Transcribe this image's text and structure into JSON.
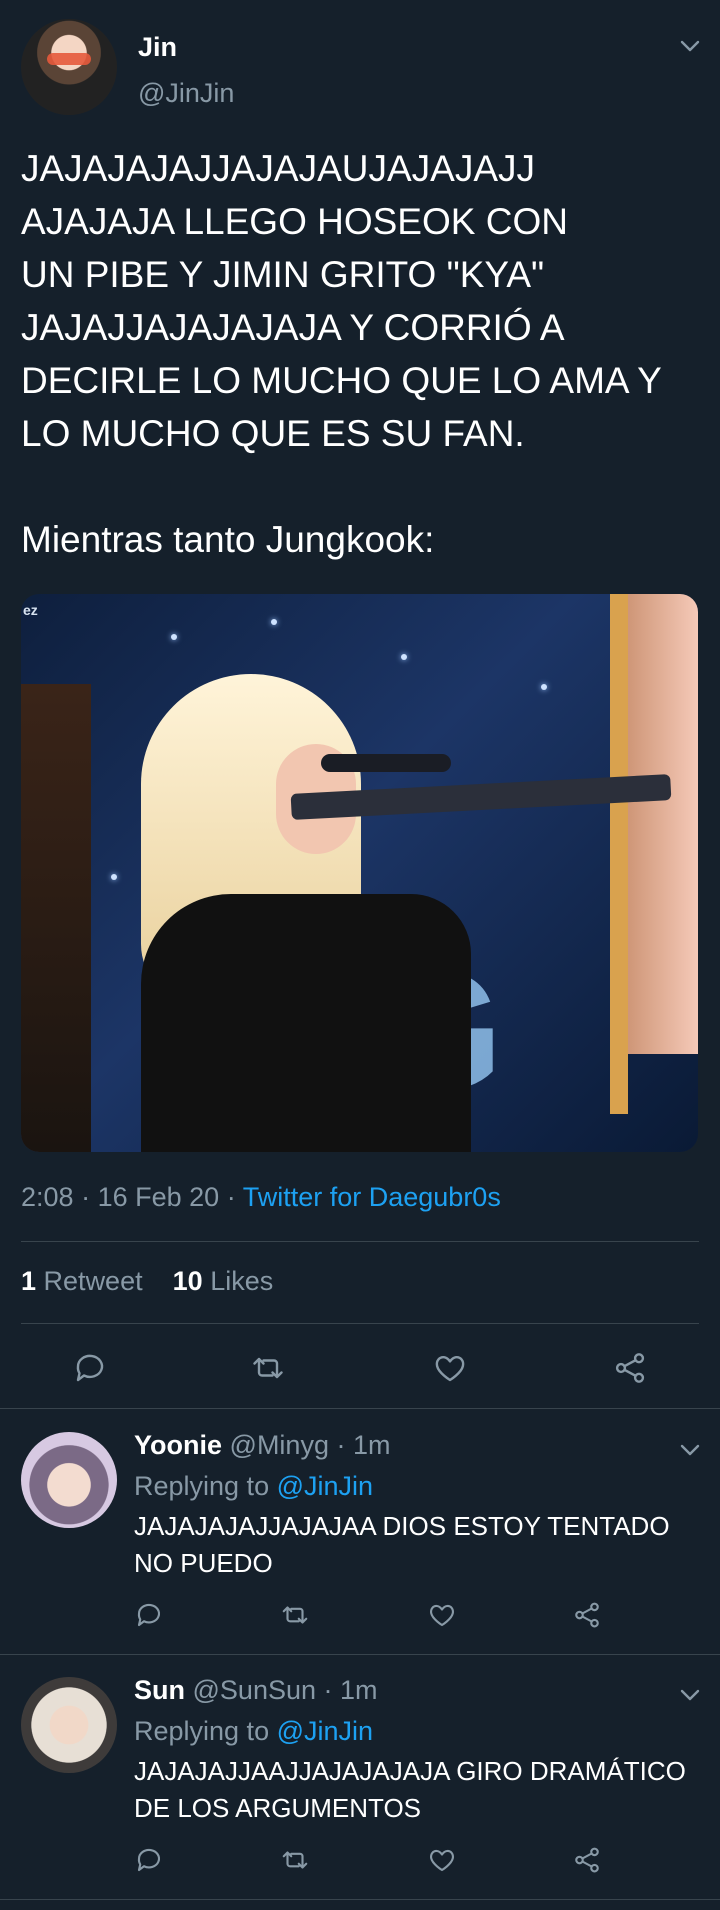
{
  "tweet": {
    "name": "Jin",
    "handle": "@JinJin",
    "text": "JAJAJAJAJJAJAJAUJAJAJAJJ\nAJAJAJA LLEGO HOSEOK CON\nUN PIBE Y JIMIN GRITO \"KYA\"\nJAJAJJAJAJAJAJA Y CORRIÓ A\nDECIRLE LO MUCHO QUE LO AMA Y\nLO MUCHO QUE ES SU FAN.\n\nMientras tanto Jungkook:",
    "media_watermark": "ez",
    "time": "2:08",
    "date": "16 Feb 20",
    "dot": "·",
    "source": "Twitter for Daegubr0s",
    "retweets_count": "1",
    "retweets_label": "Retweet",
    "likes_count": "10",
    "likes_label": "Likes"
  },
  "replies": [
    {
      "name": "Yoonie",
      "handle": "@Minyg",
      "time": "· 1m",
      "replying_label": "Replying to",
      "replying_to": "@JinJin",
      "text": "JAJAJAJAJJAJAJAA DIOS ESTOY TENTADO NO PUEDO"
    },
    {
      "name": "Sun",
      "handle": "@SunSun",
      "time": "· 1m",
      "replying_label": "Replying to",
      "replying_to": "@JinJin",
      "text": "JAJAJAJJAAJJAJAJAJAJA GIRO DRAMÁTICO DE LOS ARGUMENTOS"
    }
  ],
  "icons": [
    "chevron-down-icon",
    "reply-icon",
    "retweet-icon",
    "like-icon",
    "share-icon"
  ],
  "colors": {
    "background": "#15202b",
    "text": "#ffffff",
    "muted": "#8899a6",
    "link": "#1da1f2",
    "divider": "#38444d"
  }
}
